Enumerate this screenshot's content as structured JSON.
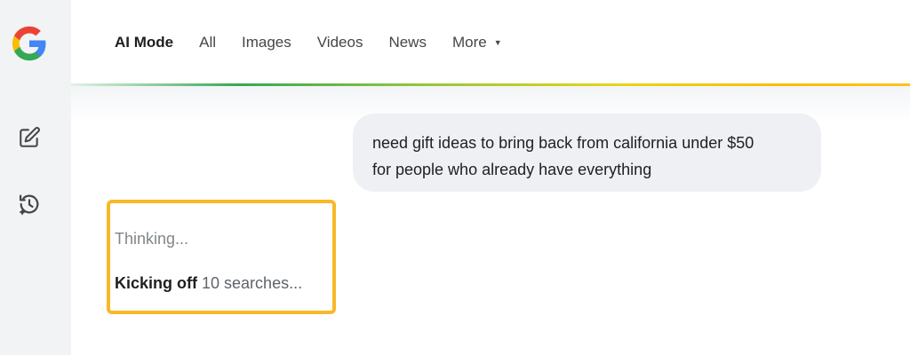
{
  "nav": {
    "tabs": [
      {
        "label": "AI Mode"
      },
      {
        "label": "All"
      },
      {
        "label": "Images"
      },
      {
        "label": "Videos"
      },
      {
        "label": "News"
      },
      {
        "label": "More"
      }
    ]
  },
  "icons": {
    "logo": "google-logo",
    "new_chat": "edit-icon",
    "history": "history-icon",
    "more": "caret-down-icon"
  },
  "colors": {
    "highlight_border": "#f9b829",
    "user_bubble": "#eef0f4",
    "rail_background": "#f1f3f4"
  },
  "conversation": {
    "user_message_line1": "need gift ideas to bring back from california under $50",
    "user_message_line2": "for people who already have everything",
    "thinking_label": "Thinking...",
    "status_strong": "Kicking off",
    "status_rest": "10 searches..."
  }
}
